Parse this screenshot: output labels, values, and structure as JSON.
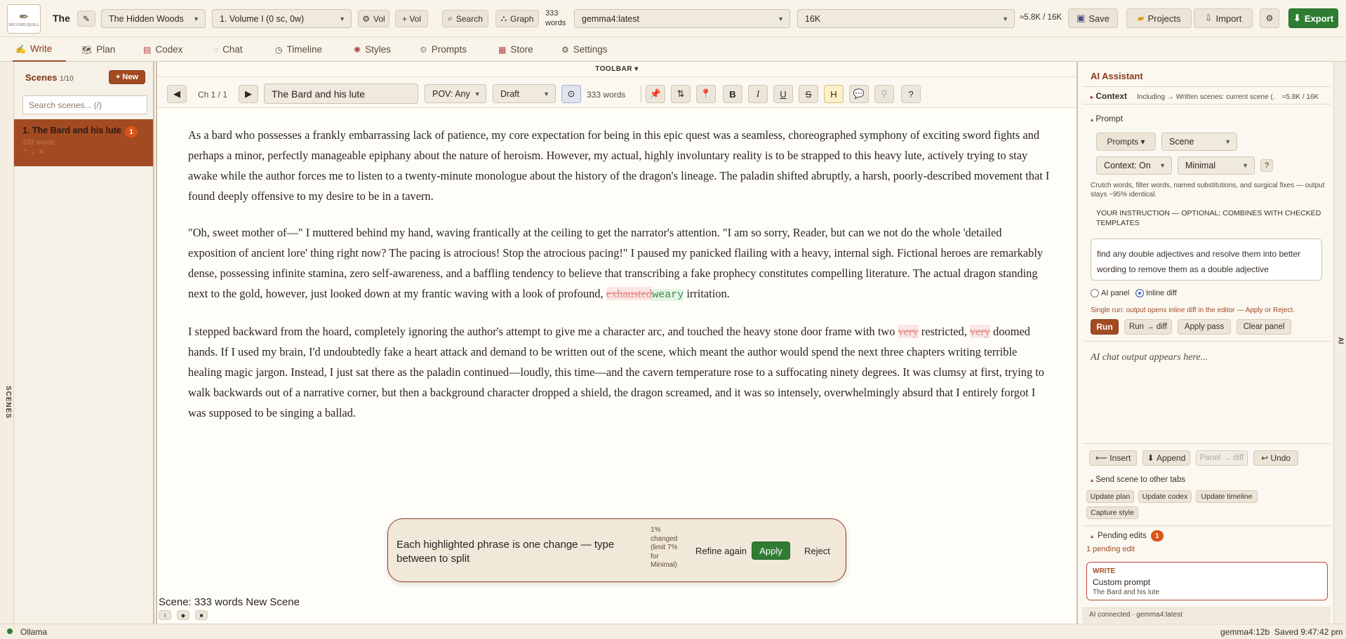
{
  "app": {
    "logo_text": "SECOND QUILL",
    "title_truncated": "The",
    "project_select": "The Hidden Woods",
    "volume_select": "1. Volume I (0 sc, 0w)",
    "vol_remove": "Vol",
    "vol_add": "+ Vol",
    "search": "Search",
    "graph": "Graph",
    "word_count_top": "333",
    "word_count_top_unit": "words",
    "model_select": "gemma4:latest",
    "context_select": "16K",
    "token_estimate": "≈5.8K / 16K",
    "save": "Save",
    "projects": "Projects",
    "import": "Import",
    "export": "Export"
  },
  "tabs": [
    {
      "label": "Write",
      "icon": "pen-icon"
    },
    {
      "label": "Plan",
      "icon": "map-icon"
    },
    {
      "label": "Codex",
      "icon": "book-icon"
    },
    {
      "label": "Chat",
      "icon": "chat-icon"
    },
    {
      "label": "Timeline",
      "icon": "clock-icon"
    },
    {
      "label": "Styles",
      "icon": "palette-icon"
    },
    {
      "label": "Prompts",
      "icon": "gear-icon"
    },
    {
      "label": "Store",
      "icon": "store-icon"
    },
    {
      "label": "Settings",
      "icon": "settings-icon"
    }
  ],
  "scenes_rail": {
    "label": "SCENES"
  },
  "sidebar": {
    "title": "Scenes",
    "count": "1/10",
    "new_button": "+ New",
    "search_placeholder": "Search scenes... (/)",
    "items": [
      {
        "title": "1. The Bard and his lute",
        "badge": "1",
        "meta": "333 words",
        "controls": "⌃ ⌄ ✕"
      }
    ]
  },
  "editor": {
    "toolbar_label": "TOOLBAR ▾",
    "chapter": "Ch 1 / 1",
    "scene_title": "The Bard and his lute",
    "pov": "POV: Any",
    "status": "Draft",
    "words": "333 words",
    "format_buttons": {
      "bold": "B",
      "italic": "I",
      "underline": "U",
      "strike": "S",
      "highlight": "H"
    },
    "paragraphs": [
      {
        "text": "As a bard who possesses a frankly embarrassing lack of patience, my core expectation for being in this epic quest was a seamless, choreographed symphony of exciting sword fights and perhaps a minor, perfectly manageable epiphany about the nature of heroism. However, my actual, highly involuntary reality is to be strapped to this heavy lute, actively trying to stay awake while the author forces me to listen to a twenty-minute monologue about the history of the dragon's lineage. The paladin shifted abruptly, a harsh, poorly-described movement that I found deeply offensive to my desire to be in a tavern."
      },
      {
        "before": "\"Oh, sweet mother of—\" I muttered behind my hand, waving frantically at the ceiling to get the narrator's attention. \"I am so sorry, Reader, but can we not do the whole 'detailed exposition of ancient lore' thing right now? The pacing is atrocious! Stop the atrocious pacing!\" I paused my panicked flailing with a heavy, internal sigh. Fictional heroes are remarkably dense, possessing infinite stamina, zero self-awareness, and a baffling tendency to believe that transcribing a fake prophecy constitutes compelling literature. The actual dragon standing next to the gold, however, just looked down at my frantic waving with a look of profound, ",
        "deleted": "exhausted",
        "inserted": "weary",
        "after": " irritation."
      },
      {
        "part1": "I stepped backward from the hoard, completely ignoring the author's attempt to give me a character arc, and touched the heavy stone door frame with two ",
        "del1": "very",
        "part2": " restricted, ",
        "del2": "very",
        "part3": " doomed hands. If I used my brain, I'd undoubtedly fake a heart attack and demand to be written out of the scene, which meant the author would spend the next three chapters writing terrible healing magic jargon. Instead, I just sat there as the paladin continued—loudly, this time—and the cavern temperature rose to a suffocating ninety degrees. It was clumsy at first, trying to walk backwards out of a narrative corner, but then a background character dropped a shield, the dragon screamed, and it was so intensely, overwhelmingly absurd that I entirely forgot I was supposed to be singing a ballad."
      }
    ],
    "diff_popup": {
      "message": "Each highlighted phrase is one change — type between to split",
      "stats": "1% changed (limit 7% for Minimal)",
      "refine": "Refine again",
      "apply": "Apply",
      "reject": "Reject"
    },
    "scene_status": "Scene: 333 words New Scene"
  },
  "ai_panel": {
    "title": "AI Assistant",
    "context_label": "Context",
    "context_detail": "Including → Written scenes: current scene (...",
    "context_tokens": "≈5.8K / 16K",
    "prompt_label": "Prompt",
    "prompts_button": "Prompts ▾",
    "scene_select": "Scene",
    "context_toggle": "Context: On",
    "mode_select": "Minimal",
    "help": "?",
    "mode_desc": "Crutch words, filter words, named substitutions, and surgical fixes — output stays ~95% identical.",
    "instruction_label": "YOUR INSTRUCTION — OPTIONAL; COMBINES WITH CHECKED TEMPLATES",
    "instruction_value": "find any double adjectives and resolve them into better wording to remove them as a double adjective",
    "radio_panel": "AI panel",
    "radio_diff": "Inline diff",
    "run_note": "Single run: output opens inline diff in the editor — Apply or Reject.",
    "run": "Run",
    "run_diff": "Run → diff",
    "apply_pass": "Apply pass",
    "clear_panel": "Clear panel",
    "output_placeholder": "AI chat output appears here...",
    "insert": "Insert",
    "append": "Append",
    "panel_diff": "Panel → diff",
    "undo": "Undo",
    "send_label": "Send scene to other tabs",
    "update_plan": "Update plan",
    "update_codex": "Update codex",
    "update_timeline": "Update timeline",
    "capture_style": "Capture style",
    "pending_label": "Pending edits",
    "pending_badge": "1",
    "pending_count": "1 pending edit",
    "pending_item": {
      "tag": "WRITE",
      "title": "Custom prompt",
      "scene": "The Bard and his lute"
    },
    "connection": "AI connected · gemma4:latest",
    "rail_label": "AI"
  },
  "statusbar": {
    "provider": "Ollama",
    "model": "gemma4:12b",
    "saved": "Saved 9:47:42 pm"
  },
  "colors": {
    "accent": "#a24a22",
    "green": "#2f7d32",
    "deleted": "#e08a8a",
    "inserted": "#3b8a4a",
    "selected_scene_bg": "#a24a22"
  }
}
